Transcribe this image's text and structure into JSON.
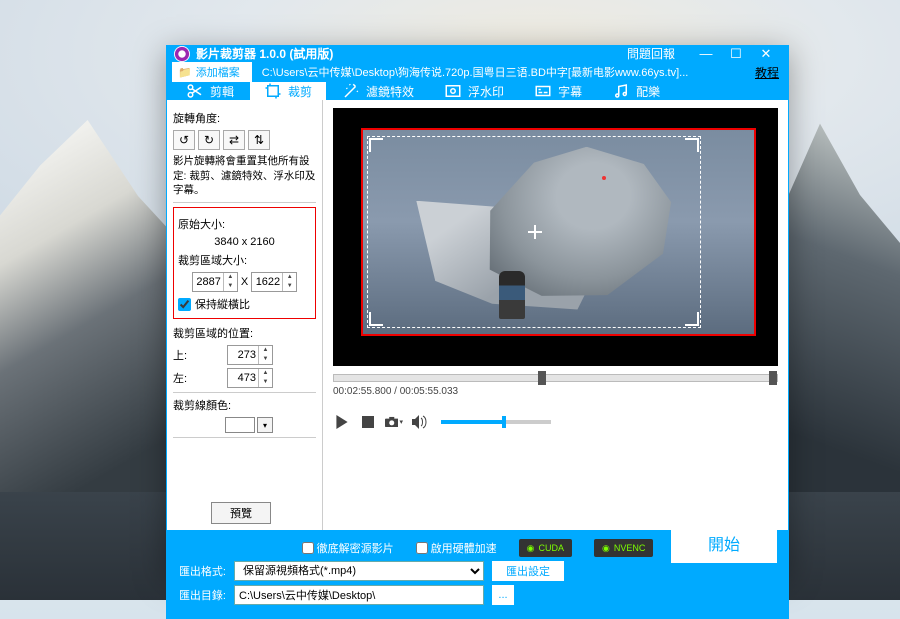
{
  "titlebar": {
    "title": "影片裁剪器 1.0.0 (試用版)",
    "feedback": "問題回報"
  },
  "filebar": {
    "add_label": "添加檔案",
    "path": "C:\\Users\\云中传媒\\Desktop\\狗海传说.720p.国粤日三语.BD中字[最新电影www.66ys.tv]...",
    "tutorial": "教程"
  },
  "tabs": {
    "trim": "剪輯",
    "crop": "裁剪",
    "filter": "濾鏡特效",
    "watermark": "浮水印",
    "subtitle": "字幕",
    "audio": "配樂"
  },
  "left": {
    "rotation_label": "旋轉角度:",
    "rotation_note": "影片旋轉將會重置其他所有設定: 裁剪、濾鏡特效、浮水印及字幕。",
    "original_size_label": "原始大小:",
    "original_size": "3840 x 2160",
    "crop_size_label": "裁剪區域大小:",
    "crop_w": "2887",
    "crop_h": "1622",
    "size_sep": "X",
    "keep_ratio": "保持縱橫比",
    "crop_pos_label": "裁剪區域的位置:",
    "top_lbl": "上:",
    "top_val": "273",
    "left_lbl": "左:",
    "left_val": "473",
    "border_color_label": "裁剪線顏色:",
    "preview_btn": "預覽"
  },
  "preview": {
    "time": "00:02:55.800 / 00:05:55.033"
  },
  "footer": {
    "chk_decrypt": "徹底解密源影片",
    "chk_hw": "啟用硬體加速",
    "badge_cuda": "CUDA",
    "badge_nvenc": "NVENC",
    "out_format_label": "匯出格式:",
    "out_format_value": "保留源視頻格式(*.mp4)",
    "out_setting_btn": "匯出設定",
    "out_dir_label": "匯出目錄:",
    "out_dir_value": "C:\\Users\\云中传媒\\Desktop\\",
    "browse": "...",
    "start": "開始"
  }
}
